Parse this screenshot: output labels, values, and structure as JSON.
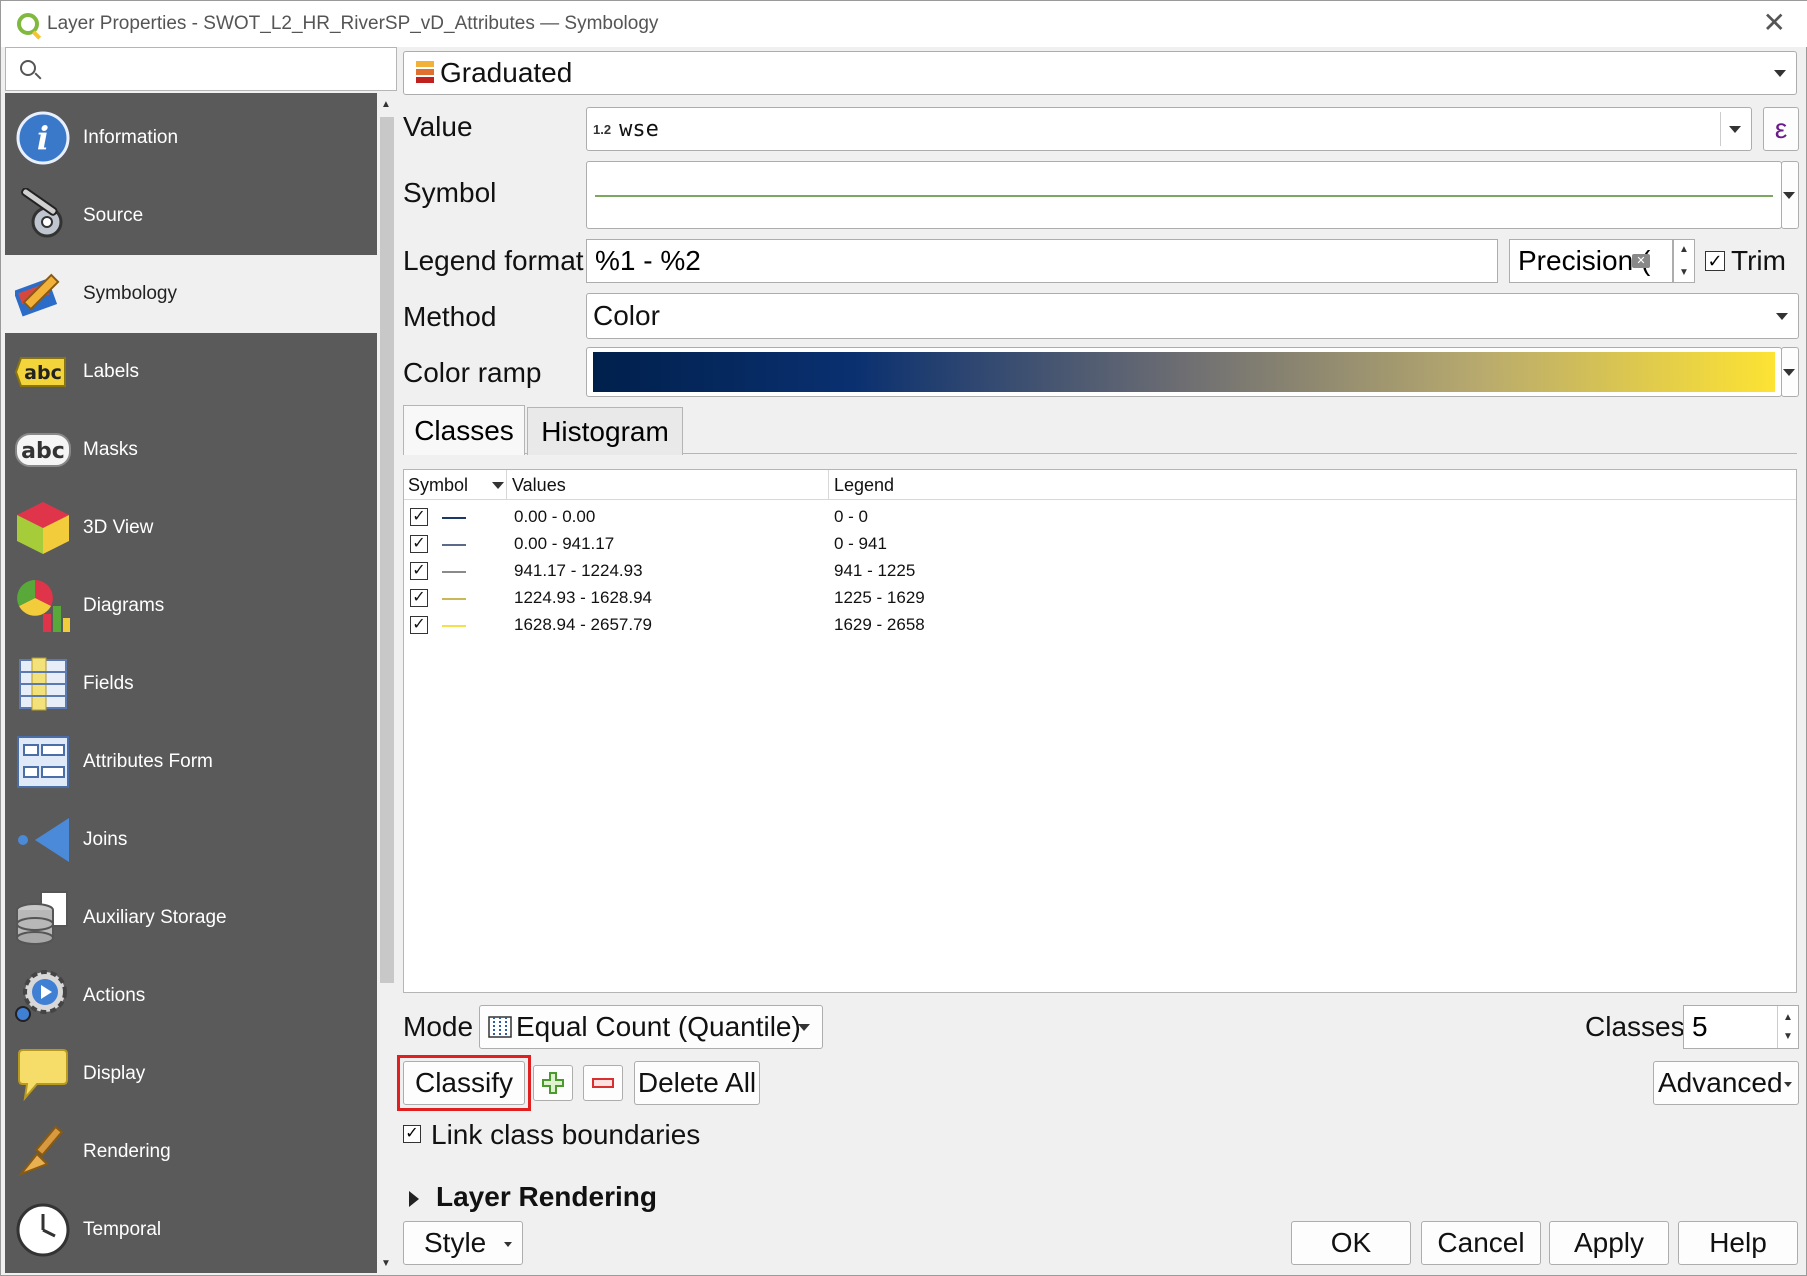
{
  "window": {
    "title": "Layer Properties - SWOT_L2_HR_RiverSP_vD_Attributes — Symbology",
    "close_glyph": "✕"
  },
  "search": {
    "placeholder": ""
  },
  "sidebar": {
    "items": [
      {
        "label": "Information",
        "icon": "information-icon"
      },
      {
        "label": "Source",
        "icon": "source-tools-icon"
      },
      {
        "label": "Symbology",
        "icon": "paintbrush-icon",
        "active": true
      },
      {
        "label": "Labels",
        "icon": "labels-abc-icon"
      },
      {
        "label": "Masks",
        "icon": "masks-abc-icon"
      },
      {
        "label": "3D View",
        "icon": "cube-icon"
      },
      {
        "label": "Diagrams",
        "icon": "diagrams-icon"
      },
      {
        "label": "Fields",
        "icon": "fields-icon"
      },
      {
        "label": "Attributes Form",
        "icon": "form-icon"
      },
      {
        "label": "Joins",
        "icon": "joins-icon"
      },
      {
        "label": "Auxiliary Storage",
        "icon": "database-icon"
      },
      {
        "label": "Actions",
        "icon": "gear-play-icon"
      },
      {
        "label": "Display",
        "icon": "speech-bubble-icon"
      },
      {
        "label": "Rendering",
        "icon": "brush-icon"
      },
      {
        "label": "Temporal",
        "icon": "clock-icon"
      }
    ]
  },
  "renderer": {
    "type_label": "Graduated"
  },
  "value": {
    "label": "Value",
    "type_prefix": "1.2",
    "field": "wse",
    "expr_glyph": "ε"
  },
  "symbol": {
    "label": "Symbol"
  },
  "legend_format": {
    "label": "Legend format",
    "value": "%1 - %2",
    "precision_label": "Precision (",
    "trim_label": "Trim",
    "trim_checked": true
  },
  "method": {
    "label": "Method",
    "value": "Color"
  },
  "color_ramp": {
    "label": "Color ramp",
    "start_color": "#00204c",
    "end_color": "#fde333"
  },
  "tabs": [
    {
      "label": "Classes",
      "active": true
    },
    {
      "label": "Histogram",
      "active": false
    }
  ],
  "classes_table": {
    "headers": {
      "symbol": "Symbol",
      "values": "Values",
      "legend": "Legend"
    },
    "rows": [
      {
        "checked": true,
        "color": "#1c3868",
        "values": "0.00 - 0.00",
        "legend": "0 - 0"
      },
      {
        "checked": true,
        "color": "#5a6a88",
        "values": "0.00 - 941.17",
        "legend": "0 - 941"
      },
      {
        "checked": true,
        "color": "#8a8a8a",
        "values": "941.17 - 1224.93",
        "legend": "941 - 1225"
      },
      {
        "checked": true,
        "color": "#c9b85a",
        "values": "1224.93 - 1628.94",
        "legend": "1225 - 1629"
      },
      {
        "checked": true,
        "color": "#f3e04a",
        "values": "1628.94 - 2657.79",
        "legend": "1629 - 2658"
      }
    ]
  },
  "mode": {
    "label": "Mode",
    "value": "Equal Count (Quantile)"
  },
  "classes_count": {
    "label": "Classes",
    "value": "5"
  },
  "buttons": {
    "classify": "Classify",
    "delete_all": "Delete All",
    "advanced": "Advanced",
    "style": "Style",
    "ok": "OK",
    "cancel": "Cancel",
    "apply": "Apply",
    "help": "Help"
  },
  "link_boundaries": {
    "label": "Link class boundaries",
    "checked": true
  },
  "layer_rendering": {
    "label": "Layer Rendering"
  },
  "accent": {
    "highlight_border": "#e02020"
  }
}
